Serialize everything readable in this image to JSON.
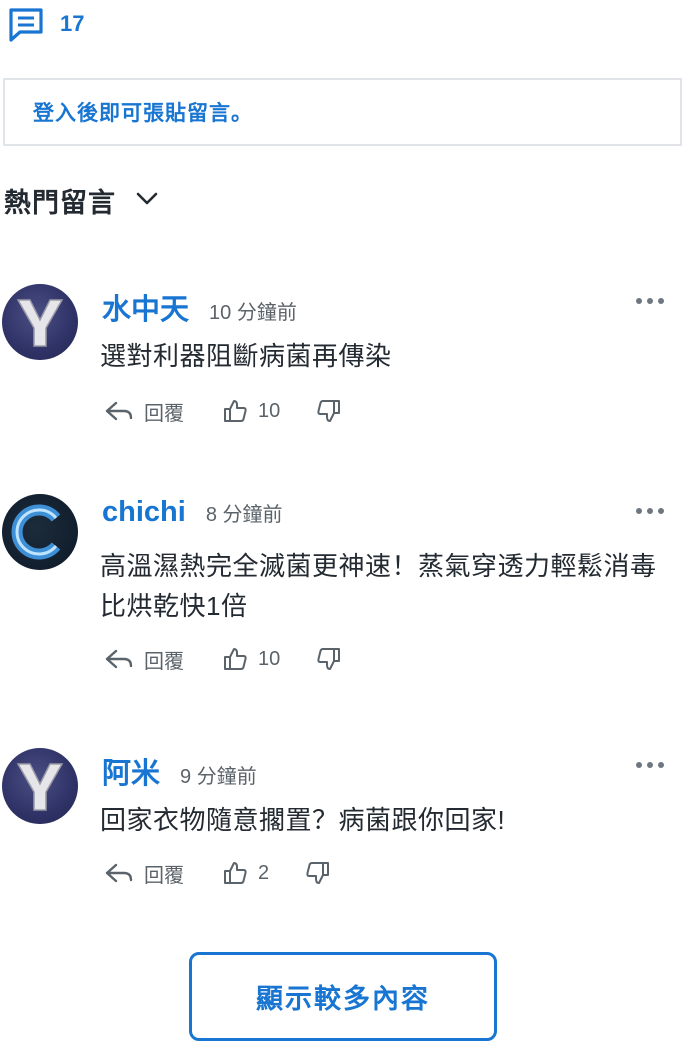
{
  "header": {
    "comment_count": "17"
  },
  "login_prompt": "登入後即可張貼留言。",
  "sort": {
    "label": "熱門留言"
  },
  "comments": [
    {
      "name": "水中天",
      "time": "10 分鐘前",
      "text": "選對利器阻斷病菌再傳染",
      "reply_label": "回覆",
      "likes": "10",
      "avatar": "Y"
    },
    {
      "name": "chichi",
      "time": "8 分鐘前",
      "text": "高溫濕熱完全滅菌更神速！蒸氣穿透力輕鬆消毒比烘乾快1倍",
      "reply_label": "回覆",
      "likes": "10",
      "avatar": "C"
    },
    {
      "name": "阿米",
      "time": "9 分鐘前",
      "text": "回家衣物隨意擱置？病菌跟你回家!",
      "reply_label": "回覆",
      "likes": "2",
      "avatar": "Y"
    }
  ],
  "show_more_label": "顯示較多內容",
  "colors": {
    "accent": "#1875d1",
    "text": "#232a31",
    "muted": "#5b636a",
    "border": "#e0e4e9"
  }
}
